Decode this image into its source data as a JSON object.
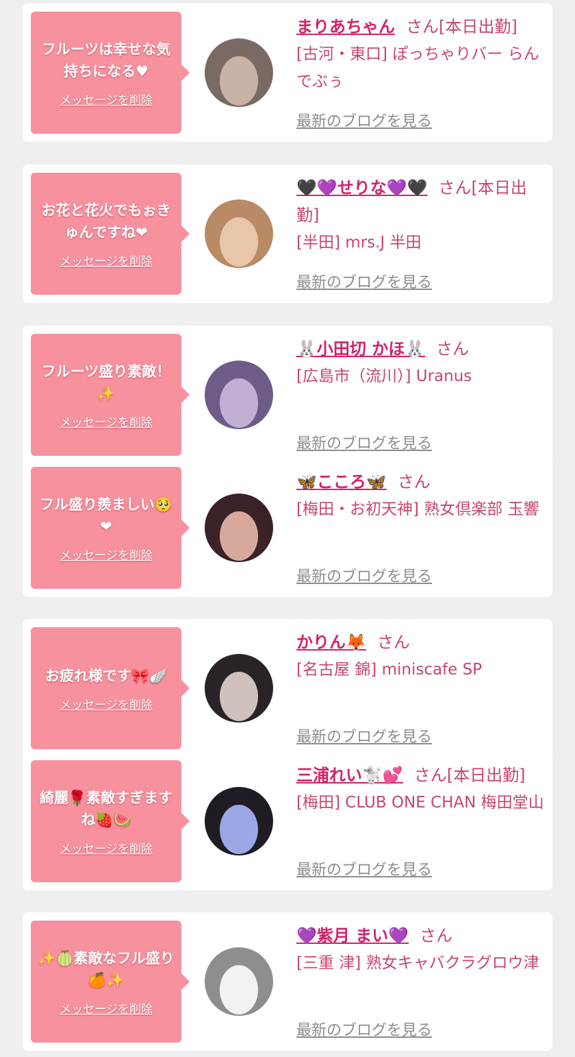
{
  "delete_label": "メッセージを削除",
  "blog_label": "最新のブログを見る",
  "cards": [
    {
      "message": "フルーツは幸せな気持ちになる♥",
      "name": "まりあちゃん",
      "suffix": "さん[本日出勤]",
      "shop": "[古河・東口] ぽっちゃりバー らんでぶぅ",
      "avatar_colors": [
        "#7a6a64",
        "#c9b2a6"
      ]
    },
    {
      "message": "お花と花火でもぉきゅんですね❤",
      "name": "🖤💜せりな💜🖤",
      "suffix": "さん[本日出勤]",
      "shop": "[半田] mrs.J 半田",
      "avatar_colors": [
        "#b88a66",
        "#e8c6a8"
      ]
    },
    {
      "message": "フルーツ盛り素敵！✨",
      "name": "🐰小田切 かほ🐰",
      "suffix": "さん",
      "shop": "[広島市（流川）] Uranus",
      "avatar_colors": [
        "#6e5b8a",
        "#c2b0d4"
      ]
    },
    {
      "message": "フル盛り羨ましい🥺❤",
      "name": "🦋こころ🦋",
      "suffix": "さん",
      "shop": "[梅田・お初天神] 熟女倶楽部 玉響",
      "avatar_colors": [
        "#3a2226",
        "#d7a99c"
      ]
    },
    {
      "message": "お疲れ様です🎀🪽",
      "name": "かりん🦊",
      "suffix": "さん",
      "shop": "[名古屋 錦] miniscafe SP",
      "avatar_colors": [
        "#2a2325",
        "#cfc2bd"
      ]
    },
    {
      "message": "綺麗🌹素敵すぎますね🍓🍉",
      "name": "三浦れい🐩💕",
      "suffix": "さん[本日出勤]",
      "shop": "[梅田] CLUB ONE CHAN 梅田堂山",
      "avatar_colors": [
        "#1f1c24",
        "#9aa8e6"
      ]
    },
    {
      "message": "✨🍈素敵なフル盛り🍊✨",
      "name": "💜紫月 まい💜",
      "suffix": "さん",
      "shop": "[三重 津] 熟女キャバクラグロウ津",
      "avatar_colors": [
        "#8e8e8e",
        "#f2f2f2"
      ]
    }
  ]
}
